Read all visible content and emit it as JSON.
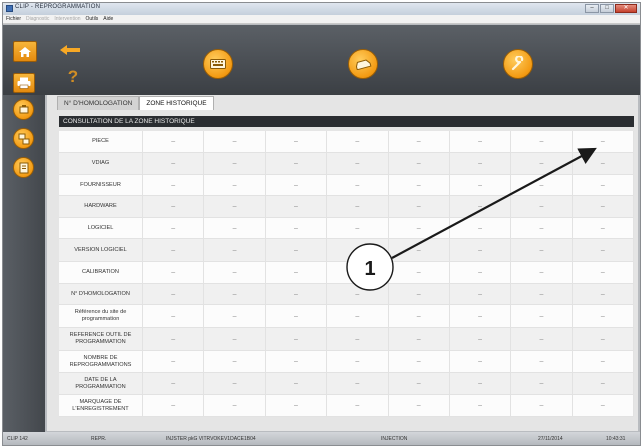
{
  "window": {
    "title": "CLIP - REPROGRAMMATION",
    "controls": [
      "–",
      "□",
      "✕"
    ]
  },
  "menubar": {
    "items": [
      {
        "label": "Fichier",
        "enabled": true
      },
      {
        "label": "Diagnostic",
        "enabled": false
      },
      {
        "label": "Intervention",
        "enabled": false
      },
      {
        "label": "Outils",
        "enabled": true
      },
      {
        "label": "Aide",
        "enabled": true
      }
    ]
  },
  "toolbar": {
    "help_glyph": "?",
    "home_icon": "home-icon",
    "back_icon": "back-arrow-icon",
    "buttons": [
      "keyboard-icon",
      "car-icon",
      "wrench-icon"
    ]
  },
  "tabs": [
    {
      "label": "N° D'HOMOLOGATION",
      "active": false
    },
    {
      "label": "ZONE HISTORIQUE",
      "active": true
    }
  ],
  "section_title": "CONSULTATION DE LA ZONE HISTORIQUE",
  "table": {
    "rows": [
      {
        "label": "PIECE",
        "values": [
          "–",
          "–",
          "–",
          "–",
          "–",
          "–",
          "–",
          "–"
        ]
      },
      {
        "label": "VDIAG",
        "values": [
          "–",
          "–",
          "–",
          "–",
          "–",
          "–",
          "–",
          "–"
        ]
      },
      {
        "label": "FOURNISSEUR",
        "values": [
          "–",
          "–",
          "–",
          "–",
          "–",
          "–",
          "–",
          "–"
        ]
      },
      {
        "label": "HARDWARE",
        "values": [
          "–",
          "–",
          "–",
          "–",
          "–",
          "–",
          "–",
          "–"
        ]
      },
      {
        "label": "LOGICIEL",
        "values": [
          "–",
          "–",
          "–",
          "–",
          "–",
          "–",
          "–",
          "–"
        ]
      },
      {
        "label": "VERSION LOGICIEL",
        "values": [
          "–",
          "–",
          "–",
          "–",
          "–",
          "–",
          "–",
          "–"
        ]
      },
      {
        "label": "CALIBRATION",
        "values": [
          "–",
          "–",
          "–",
          "–",
          "–",
          "–",
          "–",
          "–"
        ]
      },
      {
        "label": "N° D'HOMOLOGATION",
        "values": [
          "–",
          "–",
          "–",
          "–",
          "–",
          "–",
          "–",
          "–"
        ]
      },
      {
        "label": "Référence du site de programmation",
        "values": [
          "–",
          "–",
          "–",
          "–",
          "–",
          "–",
          "–",
          "–"
        ]
      },
      {
        "label": "REFERENCE OUTIL DE PROGRAMMATION",
        "values": [
          "–",
          "–",
          "–",
          "–",
          "–",
          "–",
          "–",
          "–"
        ]
      },
      {
        "label": "NOMBRE DE REPROGRAMMATIONS",
        "values": [
          "–",
          "–",
          "–",
          "–",
          "–",
          "–",
          "–",
          "–"
        ]
      },
      {
        "label": "DATE DE LA PROGRAMMATION",
        "values": [
          "–",
          "–",
          "–",
          "–",
          "–",
          "–",
          "–",
          "–"
        ]
      },
      {
        "label": "MARQUAGE DE L'ENREGISTREMENT",
        "values": [
          "–",
          "–",
          "–",
          "–",
          "–",
          "–",
          "–",
          "–"
        ]
      }
    ]
  },
  "statusbar": {
    "items": [
      "CLIP 142",
      "REPR.",
      "INJSTER pkG VITRVOKEV1DACE1B04",
      "INJECTION",
      "27/11/2014",
      "10:43:31"
    ]
  },
  "annotation": {
    "label": "1"
  },
  "colors": {
    "accent": "#f39a12",
    "chrome": "#4a4e53",
    "section_bar": "#2a2d31"
  }
}
